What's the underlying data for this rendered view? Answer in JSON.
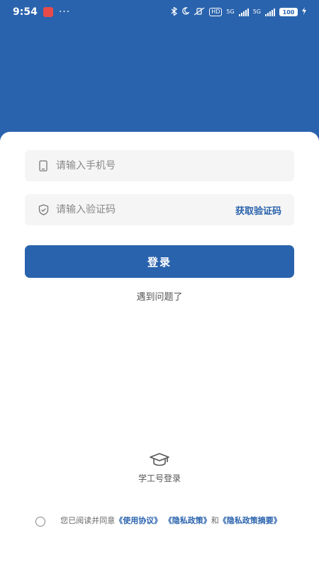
{
  "status_bar": {
    "time": "9:54",
    "more": "···",
    "hd": "HD",
    "net1": "5G",
    "net2": "5G",
    "battery": "100"
  },
  "phone_field": {
    "placeholder": "请输入手机号"
  },
  "code_field": {
    "placeholder": "请输入验证码",
    "get_code_label": "获取验证码"
  },
  "login_button": {
    "label": "登录"
  },
  "problem_link": {
    "label": "遇到问题了"
  },
  "alt_login": {
    "label": "学工号登录",
    "icon": "graduation-cap-icon"
  },
  "agreement": {
    "prefix": "您已阅读并同意",
    "terms": "《使用协议》",
    "privacy": "《隐私政策》",
    "conjunction": "和",
    "summary": "《隐私政策摘要》"
  },
  "colors": {
    "accent": "#2a63ad",
    "field_bg": "#f5f5f5",
    "text_muted": "#888888"
  }
}
